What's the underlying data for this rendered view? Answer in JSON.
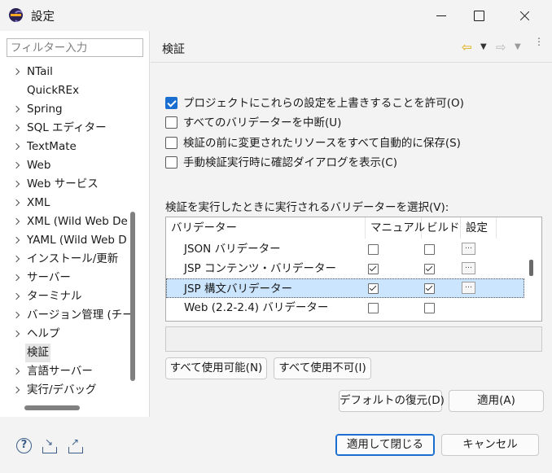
{
  "window": {
    "title": "設定"
  },
  "filter": {
    "placeholder": "フィルター入力"
  },
  "tree": {
    "items": [
      {
        "label": "NTail",
        "expandable": true
      },
      {
        "label": "QuickREx",
        "expandable": false
      },
      {
        "label": "Spring",
        "expandable": true
      },
      {
        "label": "SQL エディター",
        "expandable": true
      },
      {
        "label": "TextMate",
        "expandable": true
      },
      {
        "label": "Web",
        "expandable": true
      },
      {
        "label": "Web サービス",
        "expandable": true
      },
      {
        "label": "XML",
        "expandable": true
      },
      {
        "label": "XML (Wild Web De",
        "expandable": true
      },
      {
        "label": "YAML (Wild Web D",
        "expandable": true
      },
      {
        "label": "インストール/更新",
        "expandable": true
      },
      {
        "label": "サーバー",
        "expandable": true
      },
      {
        "label": "ターミナル",
        "expandable": true
      },
      {
        "label": "バージョン管理 (チーム",
        "expandable": true
      },
      {
        "label": "ヘルプ",
        "expandable": true
      },
      {
        "label": "検証",
        "expandable": false,
        "selected": true
      },
      {
        "label": "言語サーバー",
        "expandable": true
      },
      {
        "label": "実行/デバッグ",
        "expandable": true
      }
    ]
  },
  "page": {
    "title": "検証",
    "options": [
      {
        "label": "プロジェクトにこれらの設定を上書きすることを許可(O)",
        "checked": true
      },
      {
        "label": "すべてのバリデーターを中断(U)",
        "checked": false
      },
      {
        "label": "検証の前に変更されたリソースをすべて自動的に保存(S)",
        "checked": false
      },
      {
        "label": "手動検証実行時に確認ダイアログを表示(C)",
        "checked": false
      }
    ],
    "validators_label": "検証を実行したときに実行されるバリデーターを選択(V):",
    "table": {
      "columns": [
        "バリデーター",
        "マニュアル",
        "ビルド",
        "設定"
      ],
      "rows": [
        {
          "name": "JSON バリデーター",
          "manual": false,
          "build": false,
          "settings": "…",
          "selected": false
        },
        {
          "name": "JSP コンテンツ・バリデーター",
          "manual": true,
          "build": true,
          "settings": "…",
          "selected": false
        },
        {
          "name": "JSP 構文バリデーター",
          "manual": true,
          "build": true,
          "settings": "…",
          "selected": true
        },
        {
          "name": "Web (2.2-2.4) バリデーター",
          "manual": false,
          "build": false,
          "settings": "",
          "selected": false
        }
      ]
    },
    "enable_all": "すべて使用可能(N)",
    "disable_all": "すべて使用不可(I)",
    "restore_defaults": "デフォルトの復元(D)",
    "apply": "適用(A)"
  },
  "footer": {
    "apply_close": "適用して閉じる",
    "cancel": "キャンセル",
    "help_icon": "?"
  },
  "icons": {
    "nav_back": "⇦",
    "nav_dropdown": "▼",
    "nav_forward": "⇨",
    "more": "⋮"
  },
  "colors": {
    "accent": "#1a6ed0",
    "selection": "#cce5ff",
    "nav_back": "#e0a800"
  }
}
